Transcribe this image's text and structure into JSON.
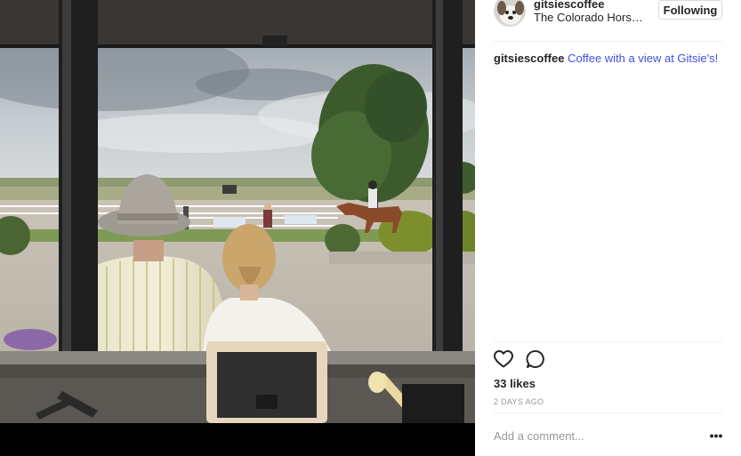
{
  "post": {
    "image_alt": "Coffee with a view at Gitsie's!",
    "header": {
      "username": "gitsiescoffee",
      "location": "The Colorado Horse Park",
      "follow_label": "Following"
    },
    "caption": {
      "username": "gitsiescoffee",
      "text": "Coffee with a view at Gitsie's!"
    },
    "actions": {
      "like_icon": "heart-icon",
      "comment_icon": "comment-icon"
    },
    "likes_text": "33 likes",
    "timestamp": "2 days ago",
    "comment": {
      "placeholder": "Add a comment...",
      "more_label": "•••"
    }
  },
  "colors": {
    "caption_link": "#3f51e0",
    "muted": "#999999",
    "divider": "#efefef"
  }
}
